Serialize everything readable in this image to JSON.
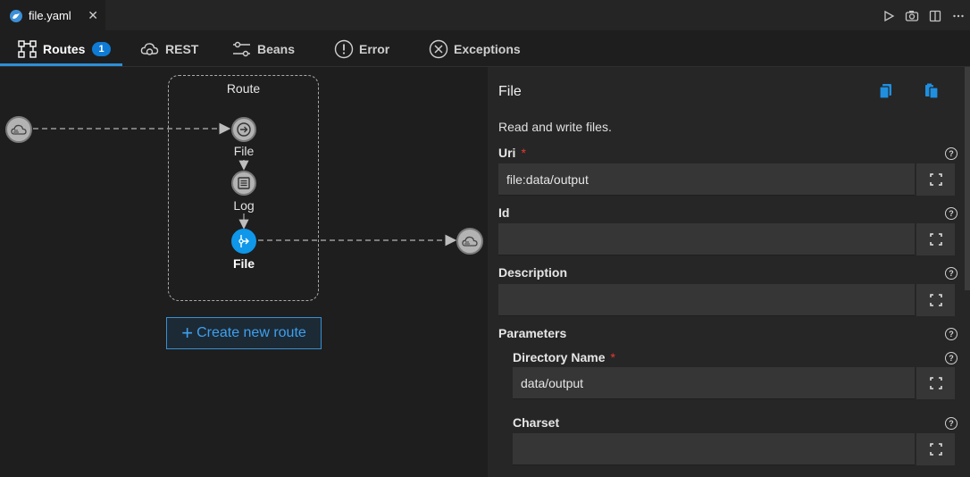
{
  "editor": {
    "file_tab": "file.yaml",
    "close_glyph": "✕",
    "actions": [
      "play-icon",
      "camera-icon",
      "split-editor-icon",
      "more-icon"
    ]
  },
  "nav": {
    "tabs": [
      {
        "label": "Routes",
        "icon": "routes-icon",
        "badge": "1",
        "active": true
      },
      {
        "label": "REST",
        "icon": "rest-cloud-icon"
      },
      {
        "label": "Beans",
        "icon": "beans-icon"
      },
      {
        "label": "Error",
        "icon": "error-icon"
      },
      {
        "label": "Exceptions",
        "icon": "exceptions-icon"
      }
    ]
  },
  "canvas": {
    "route_title": "Route",
    "steps": [
      {
        "label": "File",
        "icon": "file-consumer-icon"
      },
      {
        "label": "Log",
        "icon": "log-icon"
      },
      {
        "label": "File",
        "icon": "file-producer-icon",
        "selected": true
      }
    ],
    "create_button": "Create new route",
    "create_plus": "+"
  },
  "panel": {
    "title": "File",
    "description": "Read and write files.",
    "help_glyph": "?",
    "fields": {
      "uri": {
        "label": "Uri",
        "required": "*",
        "value": "file:data/output"
      },
      "id": {
        "label": "Id",
        "value": ""
      },
      "description": {
        "label": "Description",
        "value": ""
      },
      "parameters": {
        "label": "Parameters"
      },
      "directory_name": {
        "label": "Directory Name",
        "required": "*",
        "value": "data/output"
      },
      "charset": {
        "label": "Charset",
        "value": ""
      }
    }
  },
  "colors": {
    "accent": "#0f97ea",
    "badge": "#0f7bd4",
    "required": "#e53935"
  }
}
